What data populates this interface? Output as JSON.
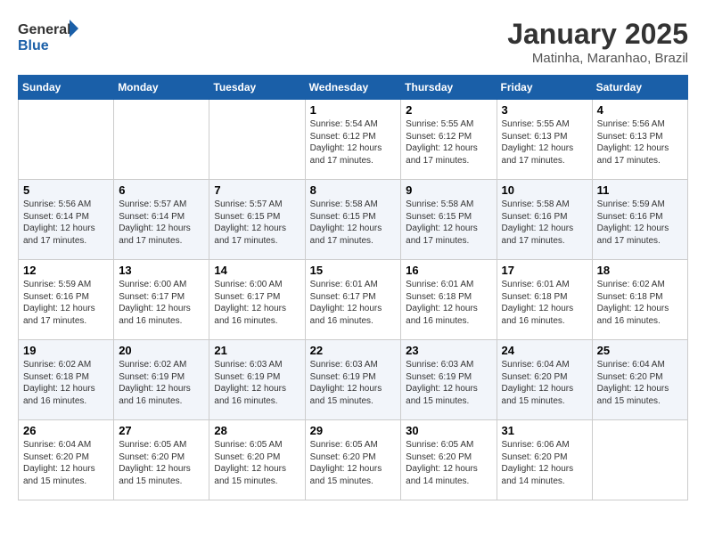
{
  "header": {
    "logo_line1": "General",
    "logo_line2": "Blue",
    "title": "January 2025",
    "subtitle": "Matinha, Maranhao, Brazil"
  },
  "days_of_week": [
    "Sunday",
    "Monday",
    "Tuesday",
    "Wednesday",
    "Thursday",
    "Friday",
    "Saturday"
  ],
  "weeks": [
    [
      {
        "day": "",
        "info": ""
      },
      {
        "day": "",
        "info": ""
      },
      {
        "day": "",
        "info": ""
      },
      {
        "day": "1",
        "info": "Sunrise: 5:54 AM\nSunset: 6:12 PM\nDaylight: 12 hours and 17 minutes."
      },
      {
        "day": "2",
        "info": "Sunrise: 5:55 AM\nSunset: 6:12 PM\nDaylight: 12 hours and 17 minutes."
      },
      {
        "day": "3",
        "info": "Sunrise: 5:55 AM\nSunset: 6:13 PM\nDaylight: 12 hours and 17 minutes."
      },
      {
        "day": "4",
        "info": "Sunrise: 5:56 AM\nSunset: 6:13 PM\nDaylight: 12 hours and 17 minutes."
      }
    ],
    [
      {
        "day": "5",
        "info": "Sunrise: 5:56 AM\nSunset: 6:14 PM\nDaylight: 12 hours and 17 minutes."
      },
      {
        "day": "6",
        "info": "Sunrise: 5:57 AM\nSunset: 6:14 PM\nDaylight: 12 hours and 17 minutes."
      },
      {
        "day": "7",
        "info": "Sunrise: 5:57 AM\nSunset: 6:15 PM\nDaylight: 12 hours and 17 minutes."
      },
      {
        "day": "8",
        "info": "Sunrise: 5:58 AM\nSunset: 6:15 PM\nDaylight: 12 hours and 17 minutes."
      },
      {
        "day": "9",
        "info": "Sunrise: 5:58 AM\nSunset: 6:15 PM\nDaylight: 12 hours and 17 minutes."
      },
      {
        "day": "10",
        "info": "Sunrise: 5:58 AM\nSunset: 6:16 PM\nDaylight: 12 hours and 17 minutes."
      },
      {
        "day": "11",
        "info": "Sunrise: 5:59 AM\nSunset: 6:16 PM\nDaylight: 12 hours and 17 minutes."
      }
    ],
    [
      {
        "day": "12",
        "info": "Sunrise: 5:59 AM\nSunset: 6:16 PM\nDaylight: 12 hours and 17 minutes."
      },
      {
        "day": "13",
        "info": "Sunrise: 6:00 AM\nSunset: 6:17 PM\nDaylight: 12 hours and 16 minutes."
      },
      {
        "day": "14",
        "info": "Sunrise: 6:00 AM\nSunset: 6:17 PM\nDaylight: 12 hours and 16 minutes."
      },
      {
        "day": "15",
        "info": "Sunrise: 6:01 AM\nSunset: 6:17 PM\nDaylight: 12 hours and 16 minutes."
      },
      {
        "day": "16",
        "info": "Sunrise: 6:01 AM\nSunset: 6:18 PM\nDaylight: 12 hours and 16 minutes."
      },
      {
        "day": "17",
        "info": "Sunrise: 6:01 AM\nSunset: 6:18 PM\nDaylight: 12 hours and 16 minutes."
      },
      {
        "day": "18",
        "info": "Sunrise: 6:02 AM\nSunset: 6:18 PM\nDaylight: 12 hours and 16 minutes."
      }
    ],
    [
      {
        "day": "19",
        "info": "Sunrise: 6:02 AM\nSunset: 6:18 PM\nDaylight: 12 hours and 16 minutes."
      },
      {
        "day": "20",
        "info": "Sunrise: 6:02 AM\nSunset: 6:19 PM\nDaylight: 12 hours and 16 minutes."
      },
      {
        "day": "21",
        "info": "Sunrise: 6:03 AM\nSunset: 6:19 PM\nDaylight: 12 hours and 16 minutes."
      },
      {
        "day": "22",
        "info": "Sunrise: 6:03 AM\nSunset: 6:19 PM\nDaylight: 12 hours and 15 minutes."
      },
      {
        "day": "23",
        "info": "Sunrise: 6:03 AM\nSunset: 6:19 PM\nDaylight: 12 hours and 15 minutes."
      },
      {
        "day": "24",
        "info": "Sunrise: 6:04 AM\nSunset: 6:20 PM\nDaylight: 12 hours and 15 minutes."
      },
      {
        "day": "25",
        "info": "Sunrise: 6:04 AM\nSunset: 6:20 PM\nDaylight: 12 hours and 15 minutes."
      }
    ],
    [
      {
        "day": "26",
        "info": "Sunrise: 6:04 AM\nSunset: 6:20 PM\nDaylight: 12 hours and 15 minutes."
      },
      {
        "day": "27",
        "info": "Sunrise: 6:05 AM\nSunset: 6:20 PM\nDaylight: 12 hours and 15 minutes."
      },
      {
        "day": "28",
        "info": "Sunrise: 6:05 AM\nSunset: 6:20 PM\nDaylight: 12 hours and 15 minutes."
      },
      {
        "day": "29",
        "info": "Sunrise: 6:05 AM\nSunset: 6:20 PM\nDaylight: 12 hours and 15 minutes."
      },
      {
        "day": "30",
        "info": "Sunrise: 6:05 AM\nSunset: 6:20 PM\nDaylight: 12 hours and 14 minutes."
      },
      {
        "day": "31",
        "info": "Sunrise: 6:06 AM\nSunset: 6:20 PM\nDaylight: 12 hours and 14 minutes."
      },
      {
        "day": "",
        "info": ""
      }
    ]
  ]
}
